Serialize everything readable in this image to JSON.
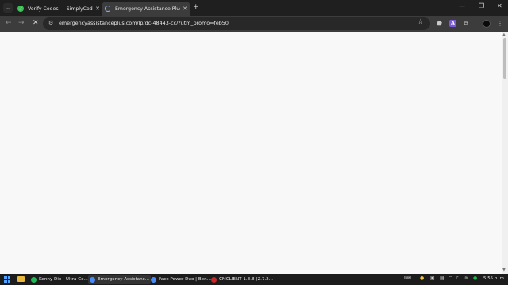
{
  "tabs": [
    {
      "title": "Verify Codes — SimplyCodes",
      "active": false,
      "favicon": "check-circle-icon",
      "favicon_color": "#3fbf5a"
    },
    {
      "title": "Emergency Assistance Plus",
      "active": true,
      "favicon": "loading-icon",
      "favicon_color": "#8fb3ff"
    }
  ],
  "tab_close": "✕",
  "new_tab": "+",
  "window": {
    "minimize": "—",
    "restore": "❐",
    "close": "✕"
  },
  "toolbar": {
    "url": "emergencyassistanceplus.com/lp/dc-48443-cc/?utm_promo=feb50",
    "back": "←",
    "forward": "→",
    "stop": "✕",
    "star": "☆",
    "ext_label": "A"
  },
  "taskbar": {
    "items": [
      {
        "label": "Kenny Die - Ultra Co...",
        "color": "#1db954",
        "active": false
      },
      {
        "label": "Emergency Assistanc...",
        "color": "#4a8cf7",
        "active": true
      },
      {
        "label": "Face Power Duo | Ben...",
        "color": "#4a8cf7",
        "active": false
      },
      {
        "label": "CMCLIENT 1.8.8 (2.7.2...",
        "color": "#c62828",
        "active": false
      }
    ],
    "clock": "5:55 p. m."
  },
  "colors": {
    "tabbar_bg": "#1f1f1f",
    "toolbar_bg": "#3c3c3c",
    "content_bg": "#f8f8f8",
    "taskbar_bg": "#1c1c1c"
  }
}
